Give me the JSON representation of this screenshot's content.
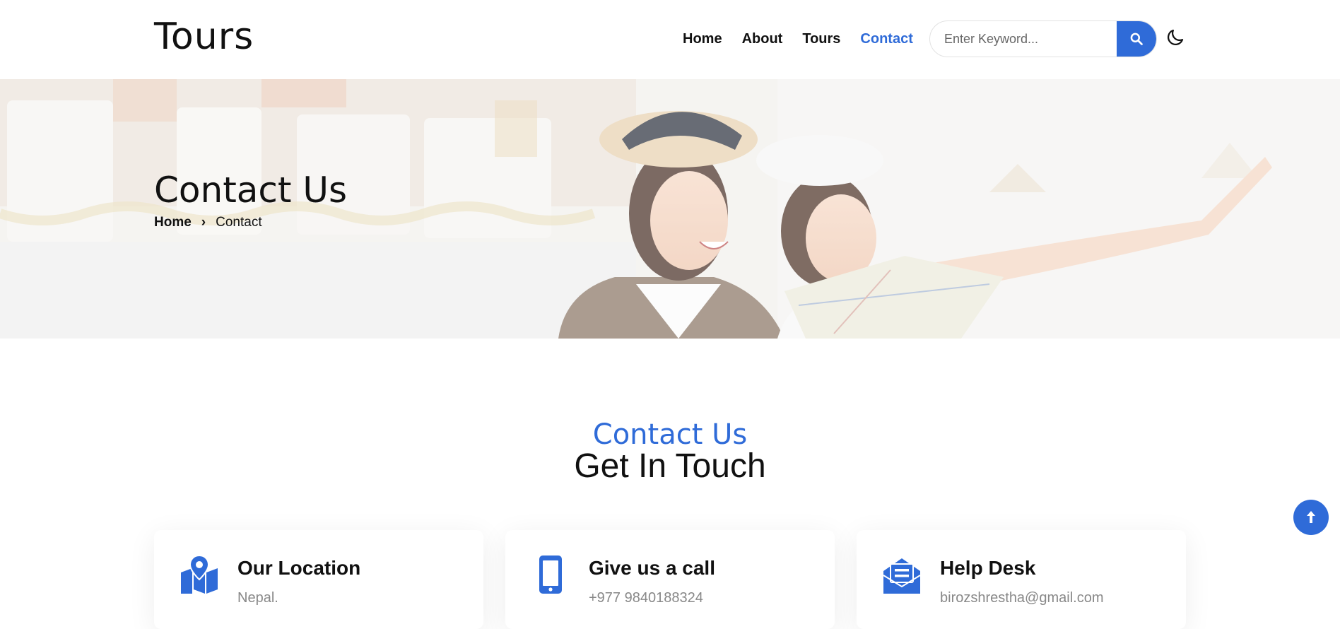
{
  "header": {
    "logo": "Tours",
    "nav": [
      "Home",
      "About",
      "Tours",
      "Contact"
    ],
    "active_nav": "Contact",
    "search_placeholder": "Enter Keyword...",
    "search_icon": "search-icon",
    "theme_icon": "moon-icon"
  },
  "hero": {
    "title": "Contact Us",
    "breadcrumb_home": "Home",
    "breadcrumb_separator": "›",
    "breadcrumb_current": "Contact"
  },
  "section": {
    "subtitle": "Contact Us",
    "title": "Get In Touch"
  },
  "cards": [
    {
      "icon": "map-location-icon",
      "title": "Our Location",
      "text": "Nepal."
    },
    {
      "icon": "mobile-phone-icon",
      "title": "Give us a call",
      "text": "+977 9840188324"
    },
    {
      "icon": "envelope-open-icon",
      "title": "Help Desk",
      "text": "birozshrestha@gmail.com"
    }
  ],
  "colors": {
    "accent": "#2f6bd8",
    "text": "#111111",
    "muted": "#888888"
  }
}
